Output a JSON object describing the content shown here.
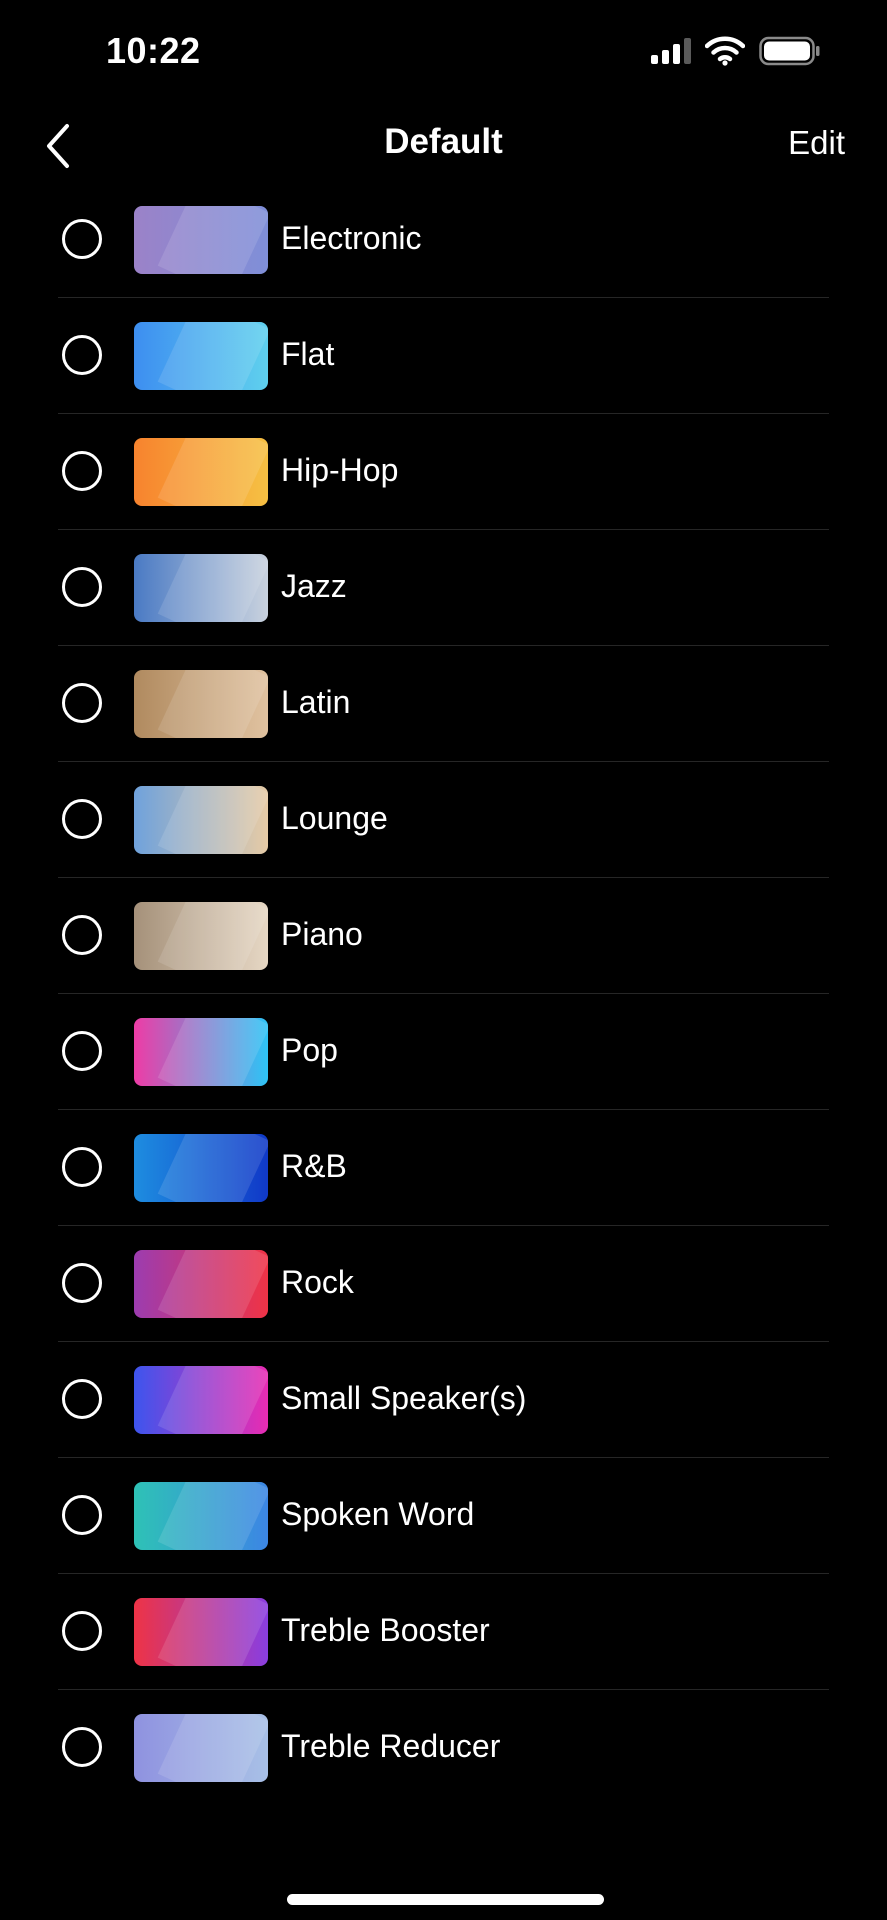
{
  "status_bar": {
    "time": "10:22",
    "signal_bars_active": 3,
    "signal_bars_total": 4,
    "icons": [
      "cellular-signal-icon",
      "wifi-icon",
      "battery-icon"
    ]
  },
  "nav": {
    "title": "Default",
    "edit_label": "Edit",
    "back_icon": "chevron-left-icon"
  },
  "presets": [
    {
      "label": "Electronic",
      "selected": false,
      "colors": [
        "#9b82c8",
        "#7f8fd8"
      ]
    },
    {
      "label": "Flat",
      "selected": false,
      "colors": [
        "#3d8ef0",
        "#5fd0ee"
      ]
    },
    {
      "label": "Hip-Hop",
      "selected": false,
      "colors": [
        "#f7832e",
        "#f6c043"
      ]
    },
    {
      "label": "Jazz",
      "selected": false,
      "colors": [
        "#4a7ac4",
        "#c9d2de"
      ]
    },
    {
      "label": "Latin",
      "selected": false,
      "colors": [
        "#b08a5f",
        "#e0c2a0"
      ]
    },
    {
      "label": "Lounge",
      "selected": false,
      "colors": [
        "#6fa2dc",
        "#e6cba6"
      ]
    },
    {
      "label": "Piano",
      "selected": false,
      "colors": [
        "#a5917a",
        "#e6d7c4"
      ]
    },
    {
      "label": "Pop",
      "selected": false,
      "colors": [
        "#ee3ca6",
        "#2ec4f6"
      ]
    },
    {
      "label": "R&B",
      "selected": false,
      "colors": [
        "#1e8de0",
        "#1039c8"
      ]
    },
    {
      "label": "Rock",
      "selected": false,
      "colors": [
        "#9c3cb0",
        "#ef3346"
      ]
    },
    {
      "label": "Small Speaker(s)",
      "selected": false,
      "colors": [
        "#3d55ee",
        "#e82cb3"
      ]
    },
    {
      "label": "Spoken Word",
      "selected": false,
      "colors": [
        "#2ec2b6",
        "#3c86e4"
      ]
    },
    {
      "label": "Treble Booster",
      "selected": false,
      "colors": [
        "#ee3346",
        "#8a3ee0"
      ]
    },
    {
      "label": "Treble Reducer",
      "selected": false,
      "colors": [
        "#8f92e0",
        "#a8c0e6"
      ]
    }
  ]
}
